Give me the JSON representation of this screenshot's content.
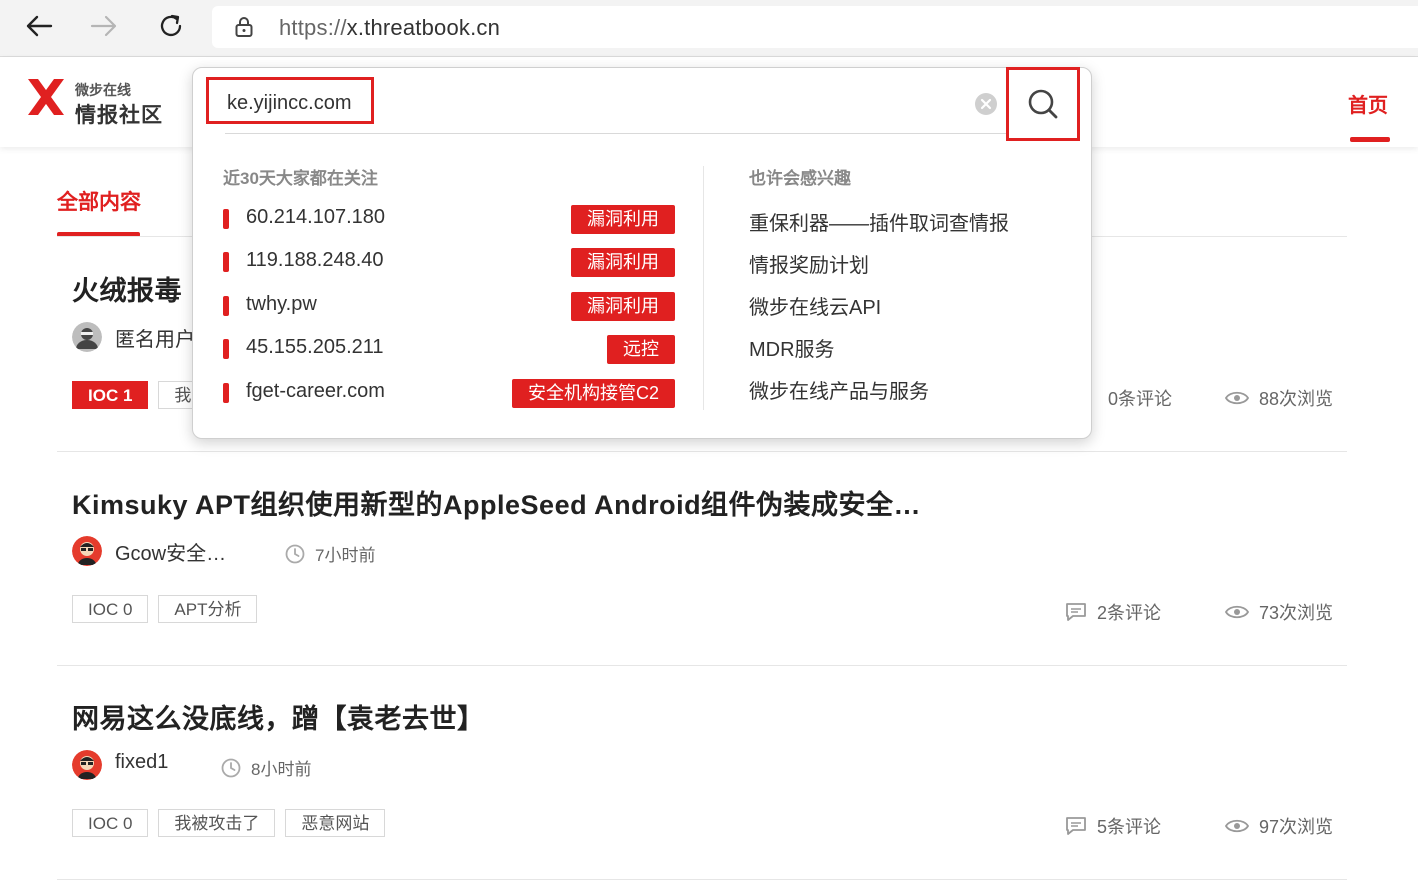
{
  "browser": {
    "url_prefix": "https://",
    "url_host": "x.threatbook.cn"
  },
  "header": {
    "logo_small": "微步在线",
    "logo_big": "情报社区",
    "nav_home": "首页"
  },
  "tabs": {
    "all": "全部内容"
  },
  "search": {
    "value": "ke.yijincc.com",
    "hot_title": "近30天大家都在关注",
    "hot_items": [
      {
        "text": "60.214.107.180",
        "badge": "漏洞利用"
      },
      {
        "text": "119.188.248.40",
        "badge": "漏洞利用"
      },
      {
        "text": "twhy.pw",
        "badge": "漏洞利用"
      },
      {
        "text": "45.155.205.211",
        "badge": "远控"
      },
      {
        "text": "fget-career.com",
        "badge": "安全机构接管C2"
      }
    ],
    "interest_title": "也许会感兴趣",
    "interest_items": [
      "重保利器——插件取词查情报",
      "情报奖励计划",
      "微步在线云API",
      "MDR服务",
      "微步在线产品与服务"
    ]
  },
  "posts": [
    {
      "title": "火绒报毒",
      "author": "匿名用户",
      "time": "",
      "tags": [
        "IOC 1",
        "我"
      ],
      "comments": "0条评论",
      "views": "88次浏览"
    },
    {
      "title": "Kimsuky APT组织使用新型的AppleSeed Android组件伪装成安全…",
      "author": "Gcow安全…",
      "time": "7小时前",
      "tags": [
        "IOC 0",
        "APT分析"
      ],
      "comments": "2条评论",
      "views": "73次浏览"
    },
    {
      "title": "网易这么没底线，蹭【袁老去世】",
      "author": "fixed1",
      "time": "8小时前",
      "tags": [
        "IOC 0",
        "我被攻击了",
        "恶意网站"
      ],
      "comments": "5条评论",
      "views": "97次浏览"
    }
  ],
  "colors": {
    "accent": "#e02020"
  }
}
